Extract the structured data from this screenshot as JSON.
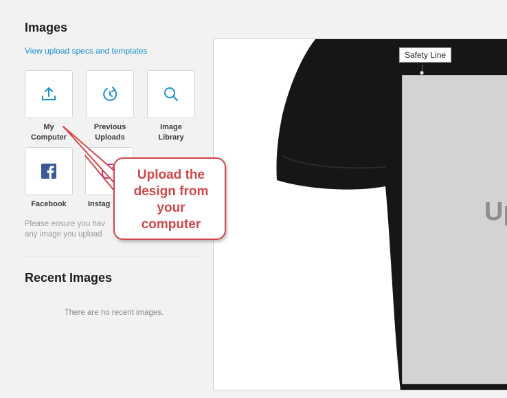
{
  "sidebar": {
    "title": "Images",
    "specs_link": "View upload specs and templates",
    "tiles": [
      {
        "label_line1": "My",
        "label_line2": "Computer",
        "icon": "upload-icon"
      },
      {
        "label_line1": "Previous",
        "label_line2": "Uploads",
        "icon": "history-icon"
      },
      {
        "label_line1": "Image",
        "label_line2": "Library",
        "icon": "search-icon"
      },
      {
        "label_line1": "Facebook",
        "icon": "facebook-icon"
      },
      {
        "label_line1": "Instag",
        "icon": "instagram-icon"
      }
    ],
    "note_line1": "Please ensure you hav",
    "note_line2": "any image you upload",
    "recent_title": "Recent Images",
    "no_recent": "There are no recent images."
  },
  "canvas": {
    "safety_label": "Safety Line",
    "upload_text": "Up"
  },
  "callout": {
    "line1": "Upload the",
    "line2": "design from",
    "line3": "your",
    "line4": "computer"
  },
  "colors": {
    "accent": "#1a8fd1",
    "facebook": "#3b5998",
    "callout": "#d0474a"
  }
}
